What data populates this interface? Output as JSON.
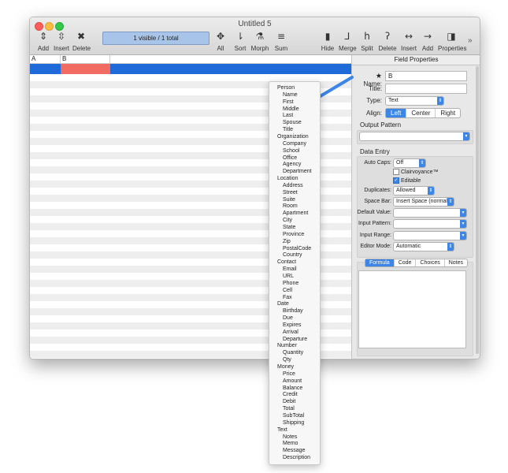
{
  "window": {
    "title": "Untitled 5"
  },
  "toolbar": {
    "status_text": "1 visible / 1 total",
    "items": [
      {
        "label": "Add",
        "icon": "add-rows-icon"
      },
      {
        "label": "Insert",
        "icon": "insert-rows-icon"
      },
      {
        "label": "Delete",
        "icon": "delete-icon"
      },
      {
        "label": "All",
        "icon": "expand-all-icon"
      },
      {
        "label": "Sort",
        "icon": "sort-icon"
      },
      {
        "label": "Morph",
        "icon": "morph-flask-icon"
      },
      {
        "label": "Sum",
        "icon": "sum-icon"
      },
      {
        "label": "Hide",
        "icon": "bookmark-icon"
      },
      {
        "label": "Merge",
        "icon": "merge-icon"
      },
      {
        "label": "Split",
        "icon": "split-icon"
      },
      {
        "label": "Delete",
        "icon": "delete-column-icon"
      },
      {
        "label": "Insert",
        "icon": "insert-column-icon"
      },
      {
        "label": "Add",
        "icon": "add-column-icon"
      },
      {
        "label": "Properties",
        "icon": "properties-panel-icon"
      }
    ],
    "overflow": "»"
  },
  "grid": {
    "columns": [
      "A",
      "B"
    ]
  },
  "properties": {
    "title": "Field Properties",
    "name_label": "Name:",
    "name_value": "B",
    "title_label": "Title:",
    "title_value": "",
    "type_label": "Type:",
    "type_value": "Text",
    "align_label": "Align:",
    "align_options": [
      "Left",
      "Center",
      "Right"
    ],
    "align_selected": "Left",
    "output_pattern_label": "Output Pattern",
    "data_entry_label": "Data Entry",
    "auto_caps_label": "Auto Caps:",
    "auto_caps_value": "Off",
    "clairvoyance_label": "Clairvoyance™",
    "editable_label": "Editable",
    "duplicates_label": "Duplicates:",
    "duplicates_value": "Allowed",
    "space_bar_label": "Space Bar:",
    "space_bar_value": "Insert Space (normal)",
    "default_value_label": "Default Value:",
    "input_pattern_label": "Input Pattern:",
    "input_range_label": "Input Range:",
    "editor_mode_label": "Editor Mode:",
    "editor_mode_value": "Automatic",
    "tabs": [
      "Formula",
      "Code",
      "Choices",
      "Notes"
    ],
    "tab_selected": "Formula"
  },
  "menu": {
    "groups": [
      {
        "name": "Person",
        "items": [
          "Name",
          "First",
          "Middle",
          "Last",
          "Spouse",
          "Title"
        ]
      },
      {
        "name": "Organization",
        "items": [
          "Company",
          "School",
          "Office",
          "Agency",
          "Department"
        ]
      },
      {
        "name": "Location",
        "items": [
          "Address",
          "Street",
          "Suite",
          "Room",
          "Apartment",
          "City",
          "State",
          "Province",
          "Zip",
          "PostalCode",
          "Country"
        ]
      },
      {
        "name": "Contact",
        "items": [
          "Email",
          "URL",
          "Phone",
          "Cell",
          "Fax"
        ]
      },
      {
        "name": "Date",
        "items": [
          "Birthday",
          "Due",
          "Expires",
          "Arrival",
          "Departure"
        ]
      },
      {
        "name": "Number",
        "items": [
          "Quantity",
          "Qty"
        ]
      },
      {
        "name": "Money",
        "items": [
          "Price",
          "Amount",
          "Balance",
          "Credit",
          "Debit",
          "Total",
          "SubTotal",
          "Shipping"
        ]
      },
      {
        "name": "Text",
        "items": [
          "Notes",
          "Memo",
          "Message",
          "Description"
        ]
      }
    ]
  },
  "colors": {
    "selection": "#1d6ad8",
    "selected_cell": "#f26b63",
    "accent": "#3d86e6"
  }
}
